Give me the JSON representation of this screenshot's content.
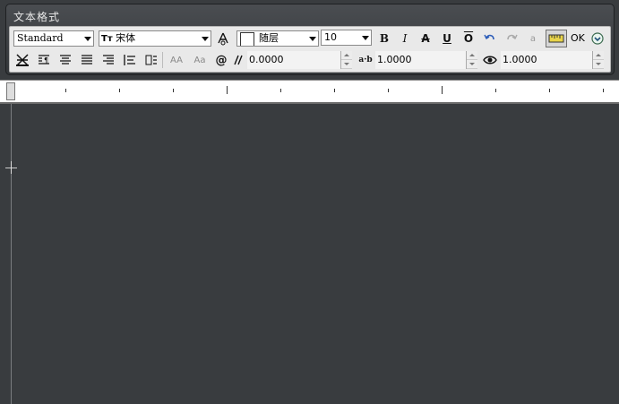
{
  "window": {
    "title": "文本格式"
  },
  "toolbar": {
    "style_combo": "Standard",
    "font_combo": "宋体",
    "font_icon": "Tт",
    "color_combo": "随层",
    "height_combo": "10",
    "bold": "B",
    "italic": "I",
    "strike": "A",
    "underline": "U",
    "overline": "O",
    "ok_label": "OK",
    "oblique_value": "0.0000",
    "tracking_icon": "a·b",
    "tracking_value": "1.0000",
    "width_value": "1.0000",
    "stack_icon": "a",
    "uppercase_icon": "AA",
    "lowercase_icon": "Aa",
    "symbol_icon": "@"
  },
  "colors": {
    "background": "#393c3f",
    "toolbar_bg": "#e9e9e9",
    "title_text": "#e8e8e8"
  }
}
